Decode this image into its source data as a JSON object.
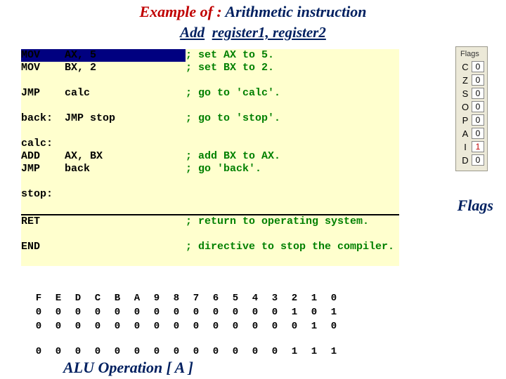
{
  "title": {
    "prefix": "Example of : ",
    "main": "Arithmetic instruction"
  },
  "subtitle": {
    "instr": "Add",
    "args": "register1, register2"
  },
  "code": {
    "l1_lbl": "MOV",
    "l1_op": "AX, 5",
    "l1_cmt": "; set AX to 5.",
    "l2_lbl": "MOV",
    "l2_op": "BX, 2",
    "l2_cmt": "; set BX to 2.",
    "l3_lbl": "JMP",
    "l3_op": "calc",
    "l3_cmt": "; go to 'calc'.",
    "l4_lbl": "back:",
    "l4_op": "JMP stop",
    "l4_cmt": "; go to 'stop'.",
    "l5_lbl": "calc:",
    "l6_lbl": "ADD",
    "l6_op": "AX, BX",
    "l6_cmt": "; add BX to AX.",
    "l7_lbl": "JMP",
    "l7_op": "back",
    "l7_cmt": "; go 'back'.",
    "l8_lbl": "stop:",
    "l9_lbl": "RET",
    "l9_cmt": "; return to operating system.",
    "l10_lbl": "END",
    "l10_cmt": "; directive to stop the compiler."
  },
  "grid": {
    "headers": [
      "F",
      "E",
      "D",
      "C",
      "B",
      "A",
      "9",
      "8",
      "7",
      "6",
      "5",
      "4",
      "3",
      "2",
      "1",
      "0"
    ],
    "r1": [
      "0",
      "0",
      "0",
      "0",
      "0",
      "0",
      "0",
      "0",
      "0",
      "0",
      "0",
      "0",
      "0",
      "1",
      "0",
      "1"
    ],
    "r2": [
      "0",
      "0",
      "0",
      "0",
      "0",
      "0",
      "0",
      "0",
      "0",
      "0",
      "0",
      "0",
      "0",
      "0",
      "1",
      "0"
    ],
    "r3": [
      "0",
      "0",
      "0",
      "0",
      "0",
      "0",
      "0",
      "0",
      "0",
      "0",
      "0",
      "0",
      "0",
      "1",
      "1",
      "1"
    ]
  },
  "alu_caption": "ALU Operation  [ A ]",
  "flags": {
    "header": "Flags",
    "rows": [
      {
        "label": "C",
        "value": "0",
        "red": false
      },
      {
        "label": "Z",
        "value": "0",
        "red": false
      },
      {
        "label": "S",
        "value": "0",
        "red": false
      },
      {
        "label": "O",
        "value": "0",
        "red": false
      },
      {
        "label": "P",
        "value": "0",
        "red": false
      },
      {
        "label": "A",
        "value": "0",
        "red": false
      },
      {
        "label": "I",
        "value": "1",
        "red": true
      },
      {
        "label": "D",
        "value": "0",
        "red": false
      }
    ]
  },
  "flags_caption": "Flags"
}
